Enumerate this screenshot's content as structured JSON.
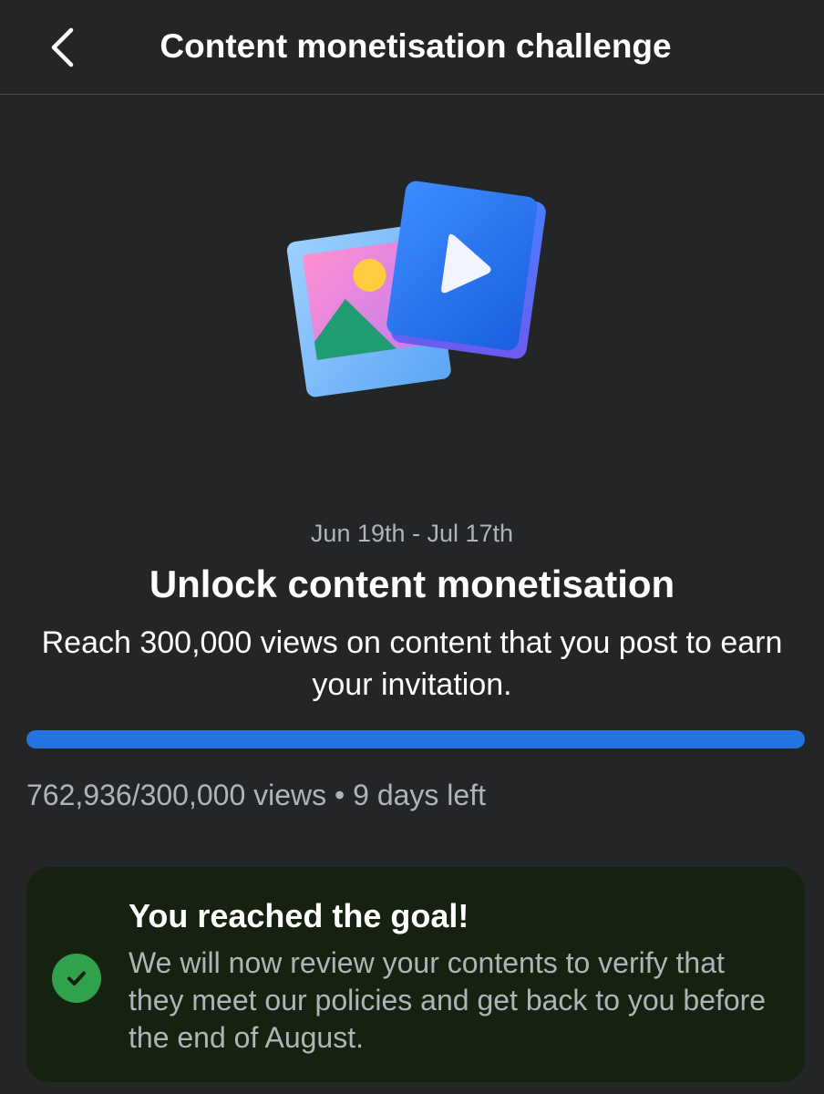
{
  "header": {
    "title": "Content monetisation challenge",
    "back_icon": "chevron-left-icon"
  },
  "illustration": {
    "icon": "photo-and-video-icon"
  },
  "challenge": {
    "date_range": "Jun 19th - Jul 17th",
    "title": "Unlock content monetisation",
    "description": "Reach 300,000 views on content that you post to earn your invitation."
  },
  "progress": {
    "current_views": 762936,
    "target_views": 300000,
    "fraction": 1.0,
    "text": "762,936/300,000 views • 9 days left",
    "color": "#2374e1"
  },
  "success": {
    "icon": "check-circle-icon",
    "title": "You reached the goal!",
    "message": "We will now review your contents to verify that they meet our policies and get back to you before the end of August.",
    "color": "#31a24c"
  }
}
